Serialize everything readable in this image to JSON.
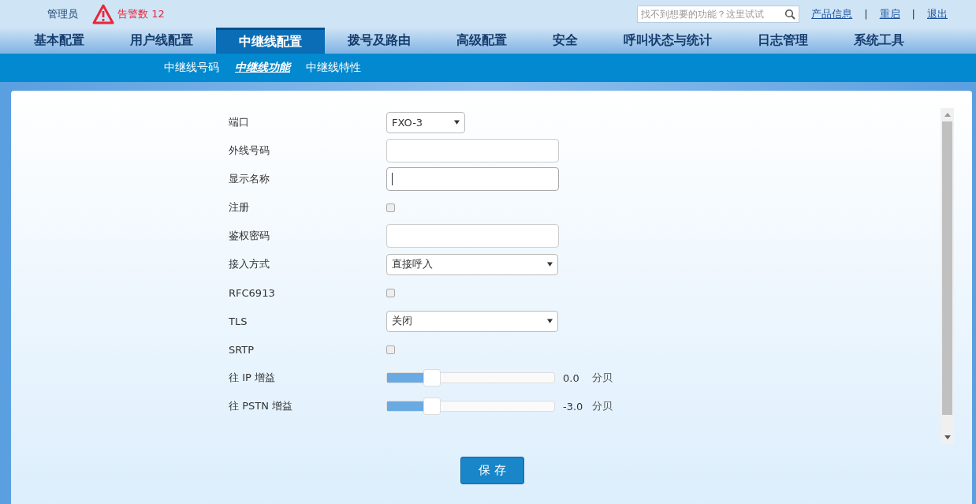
{
  "top_bar": {
    "user": "管理员",
    "alarm": "告警数 12",
    "search": {
      "placeholder": "找不到想要的功能？这里试试"
    },
    "links": [
      "产品信息",
      "重启",
      "退出"
    ],
    "separator": "|"
  },
  "nav": [
    {
      "label": "基本配置",
      "selected": false
    },
    {
      "label": "用户线配置",
      "selected": false
    },
    {
      "label": "中继线配置",
      "selected": true
    },
    {
      "label": "拨号及路由",
      "selected": false
    },
    {
      "label": "高级配置",
      "selected": false
    },
    {
      "label": "安全",
      "selected": false
    },
    {
      "label": "呼叫状态与统计",
      "selected": false
    },
    {
      "label": "日志管理",
      "selected": false
    },
    {
      "label": "系统工具",
      "selected": false
    }
  ],
  "subnav": [
    {
      "label": "中继线号码",
      "selected": false
    },
    {
      "label": "中继线功能",
      "selected": true
    },
    {
      "label": "中继线特性",
      "selected": false
    }
  ],
  "form": [
    {
      "kind": "select",
      "label": "端口",
      "value": "FXO-3",
      "short": true
    },
    {
      "kind": "text",
      "label": "外线号码",
      "focused": false
    },
    {
      "kind": "text",
      "label": "显示名称",
      "focused": true
    },
    {
      "kind": "checkbox",
      "label": "注册",
      "checked": false
    },
    {
      "kind": "text",
      "label": "鉴权密码",
      "focused": false
    },
    {
      "kind": "select",
      "label": "接入方式",
      "value": "直接呼入",
      "short": false
    },
    {
      "kind": "checkbox",
      "label": "RFC6913",
      "checked": false
    },
    {
      "kind": "select",
      "label": "TLS",
      "value": "关闭",
      "short": false
    },
    {
      "kind": "checkbox",
      "label": "SRTP",
      "checked": false
    },
    {
      "kind": "slider",
      "label": "往 IP 增益",
      "level": 0.27,
      "reading": "0.0",
      "unit": "分贝"
    },
    {
      "kind": "slider",
      "label": "往 PSTN 增益",
      "level": 0.27,
      "reading": "-3.0",
      "unit": "分贝"
    }
  ],
  "save_button": "保 存"
}
